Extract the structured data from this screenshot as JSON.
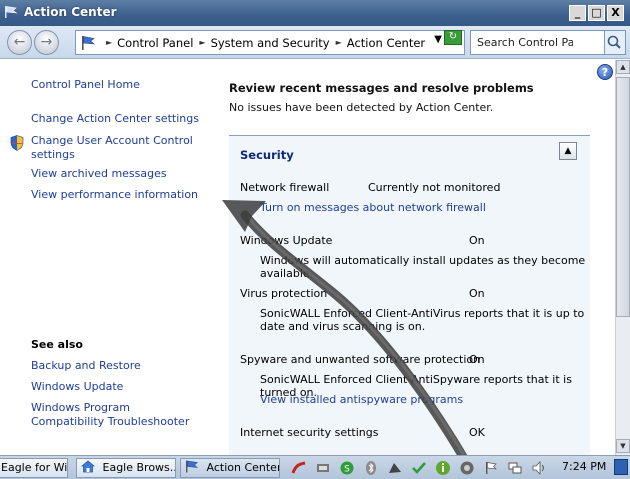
{
  "window": {
    "title": "Action Center",
    "buttons": [
      "_",
      "□",
      "X"
    ]
  },
  "address_bar": {
    "breadcrumbs": [
      "Control Panel",
      "System and Security",
      "Action Center"
    ],
    "search_placeholder": "Search Control Panel"
  },
  "sidebar": {
    "home": "Control Panel Home",
    "links": [
      "Change Action Center settings",
      "Change User Account Control settings",
      "View archived messages",
      "View performance information"
    ],
    "see_also_title": "See also",
    "see_also": [
      "Backup and Restore",
      "Windows Update",
      "Windows Program Compatibility Troubleshooter"
    ]
  },
  "main": {
    "heading": "Review recent messages and resolve problems",
    "subheading": "No issues have been detected by Action Center.",
    "security": {
      "title": "Security",
      "items": [
        {
          "name": "Network firewall",
          "status": "Currently not monitored",
          "link": "Turn on messages about network firewall"
        },
        {
          "name": "Windows Update",
          "status": "On",
          "description": "Windows will automatically install updates as they become available."
        },
        {
          "name": "Virus protection",
          "status": "On",
          "description": "SonicWALL Enforced Client-AntiVirus reports that it is up to date and virus scanning is on."
        },
        {
          "name": "Spyware and unwanted software protection",
          "status": "On",
          "description": "SonicWALL Enforced Client-AntiSpyware reports that it is turned on.",
          "link": "View installed antispyware programs"
        },
        {
          "name": "Internet security settings",
          "status": "OK"
        }
      ]
    }
  },
  "taskbar": {
    "tasks": [
      "Eagle for Wi...",
      "Eagle Brows...",
      "Action Center"
    ],
    "clock": "7:24 PM"
  }
}
